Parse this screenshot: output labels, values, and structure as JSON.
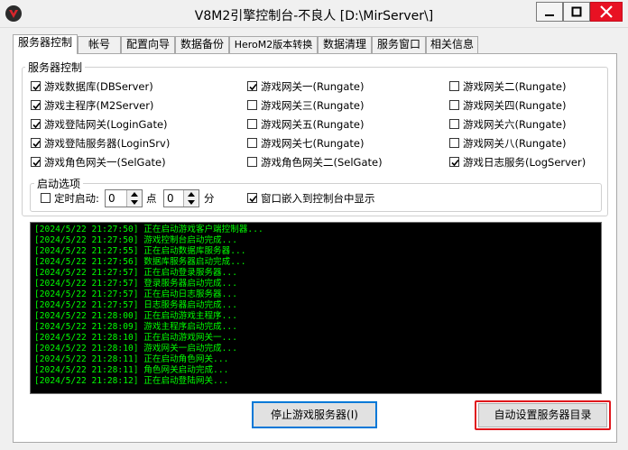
{
  "window": {
    "title": "V8M2引擎控制台-不良人 [D:\\MirServer\\]"
  },
  "tabs": [
    {
      "label": "服务器控制",
      "active": true
    },
    {
      "label": "帐号"
    },
    {
      "label": "配置向导"
    },
    {
      "label": "数据备份"
    },
    {
      "label": "HeroM2版本转换"
    },
    {
      "label": "数据清理"
    },
    {
      "label": "服务窗口"
    },
    {
      "label": "相关信息"
    }
  ],
  "server_group": {
    "title": "服务器控制",
    "checkboxes": [
      {
        "label": "游戏数据库(DBServer)",
        "checked": true
      },
      {
        "label": "游戏主程序(M2Server)",
        "checked": true
      },
      {
        "label": "游戏登陆网关(LoginGate)",
        "checked": true
      },
      {
        "label": "游戏登陆服务器(LoginSrv)",
        "checked": true
      },
      {
        "label": "游戏角色网关一(SelGate)",
        "checked": true
      },
      {
        "label": "游戏网关一(Rungate)",
        "checked": true
      },
      {
        "label": "游戏网关三(Rungate)",
        "checked": false
      },
      {
        "label": "游戏网关五(Rungate)",
        "checked": false
      },
      {
        "label": "游戏网关七(Rungate)",
        "checked": false
      },
      {
        "label": "游戏角色网关二(SelGate)",
        "checked": false
      },
      {
        "label": "游戏网关二(Rungate)",
        "checked": false
      },
      {
        "label": "游戏网关四(Rungate)",
        "checked": false
      },
      {
        "label": "游戏网关六(Rungate)",
        "checked": false
      },
      {
        "label": "游戏网关八(Rungate)",
        "checked": false
      },
      {
        "label": "游戏日志服务(LogServer)",
        "checked": true
      }
    ]
  },
  "startup": {
    "title": "启动选项",
    "timed_label": "定时启动:",
    "timed_checked": false,
    "hour_value": "0",
    "hour_unit": "点",
    "minute_value": "0",
    "minute_unit": "分",
    "embed_label": "窗口嵌入到控制台中显示",
    "embed_checked": true
  },
  "log": {
    "color": "#00ff00",
    "lines": [
      "[2024/5/22 21:27:50] 正在启动游戏客户端控制器...",
      "[2024/5/22 21:27:50] 游戏控制台启动完成...",
      "[2024/5/22 21:27:55] 正在启动数据库服务器...",
      "[2024/5/22 21:27:56] 数据库服务器启动完成...",
      "[2024/5/22 21:27:57] 正在启动登录服务器...",
      "[2024/5/22 21:27:57] 登录服务器启动完成...",
      "[2024/5/22 21:27:57] 正在启动日志服务器...",
      "[2024/5/22 21:27:57] 日志服务器启动完成...",
      "[2024/5/22 21:28:00] 正在启动游戏主程序...",
      "[2024/5/22 21:28:09] 游戏主程序启动完成...",
      "[2024/5/22 21:28:10] 正在启动游戏网关一...",
      "[2024/5/22 21:28:10] 游戏网关一启动完成...",
      "[2024/5/22 21:28:11] 正在启动角色网关...",
      "[2024/5/22 21:28:11] 角色网关启动完成...",
      "[2024/5/22 21:28:12] 正在启动登陆网关..."
    ]
  },
  "buttons": {
    "stop_label": "停止游戏服务器(I)",
    "auto_dir_label": "自动设置服务器目录"
  },
  "colors": {
    "highlight": "#e0161b",
    "close": "#e81123"
  },
  "icons": [
    "app-logo-icon",
    "minimize-icon",
    "maximize-icon",
    "close-icon",
    "checkmark-icon",
    "spin-up-icon",
    "spin-down-icon"
  ]
}
